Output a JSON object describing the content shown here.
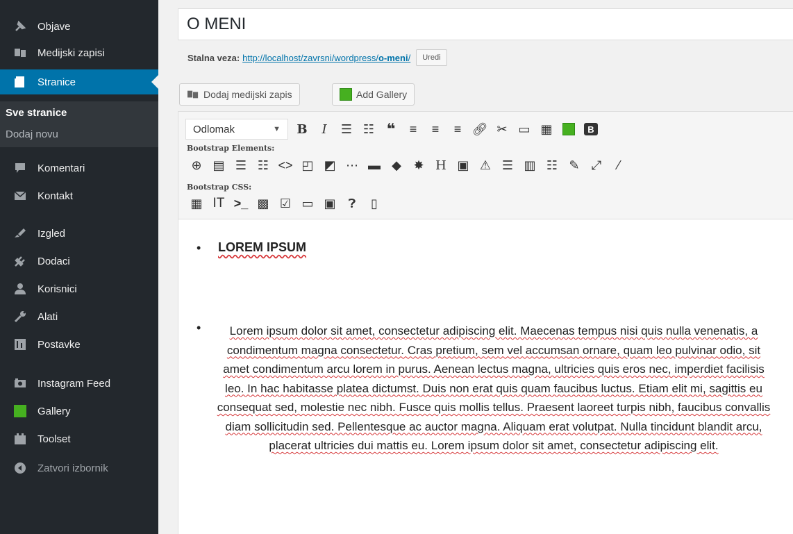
{
  "sidebar": {
    "items": [
      {
        "label": "Objave",
        "icon": "pin-icon"
      },
      {
        "label": "Medijski zapisi",
        "icon": "media-icon"
      },
      {
        "label": "Stranice",
        "icon": "pages-icon",
        "active": true
      },
      {
        "label": "Komentari",
        "icon": "comments-icon"
      },
      {
        "label": "Kontakt",
        "icon": "mail-icon"
      },
      {
        "label": "Izgled",
        "icon": "appearance-icon"
      },
      {
        "label": "Dodaci",
        "icon": "plugins-icon"
      },
      {
        "label": "Korisnici",
        "icon": "users-icon"
      },
      {
        "label": "Alati",
        "icon": "tools-icon"
      },
      {
        "label": "Postavke",
        "icon": "settings-icon"
      },
      {
        "label": "Instagram Feed",
        "icon": "instagram-icon"
      },
      {
        "label": "Gallery",
        "icon": "gallery-icon"
      },
      {
        "label": "Toolset",
        "icon": "toolset-icon"
      },
      {
        "label": "Zatvori izbornik",
        "icon": "collapse-icon"
      }
    ],
    "submenu": {
      "current": "Sve stranice",
      "add_new": "Dodaj novu"
    }
  },
  "page": {
    "title": "O MENI",
    "permalink_label": "Stalna veza:",
    "permalink_base": "http://localhost/zavrsni/wordpress/",
    "permalink_slug": "o-meni",
    "permalink_end": "/",
    "edit_label": "Uredi"
  },
  "buttons": {
    "add_media": "Dodaj medijski zapis",
    "add_gallery": "Add Gallery"
  },
  "toolbar": {
    "format_select": "Odlomak",
    "bootstrap_elements_label": "Bootstrap Elements:",
    "bootstrap_css_label": "Bootstrap CSS:",
    "badge_b": "B",
    "heading_h": "H",
    "bold": "B",
    "italic": "I"
  },
  "content": {
    "heading": "LOREM IPSUM",
    "paragraph": "Lorem ipsum dolor sit amet, consectetur adipiscing elit. Maecenas tempus nisi quis nulla venenatis, a condimentum magna consectetur. Cras pretium, sem vel accumsan ornare, quam leo pulvinar odio, sit amet condimentum arcu lorem in purus. Aenean lectus magna, ultricies quis eros nec, imperdiet facilisis leo. In hac habitasse platea dictumst. Duis non erat quis quam faucibus luctus. Etiam elit mi, sagittis eu consequat sed, molestie nec nibh. Fusce quis mollis tellus. Praesent laoreet turpis nibh, faucibus convallis diam sollicitudin sed. Pellentesque ac auctor magna. Aliquam erat volutpat. Nulla tincidunt blandit arcu, placerat ultricies dui mattis eu. Lorem ipsum dolor sit amet, consectetur adipiscing elit."
  },
  "colors": {
    "sidebar_bg": "#23282d",
    "active_bg": "#0073aa",
    "link": "#0073aa",
    "spellcheck": "#d63638",
    "green": "#46b020"
  }
}
